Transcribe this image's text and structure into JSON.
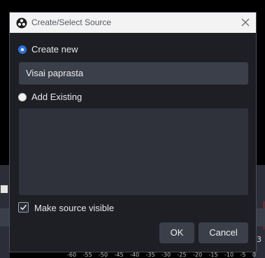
{
  "background": {
    "scale_labels": [
      "-60",
      "-55",
      "-50",
      "-45",
      "-40",
      "-35",
      "-30",
      "-25",
      "-20",
      "-15",
      "-10",
      "-5",
      "0"
    ],
    "right_number": "3"
  },
  "dialog": {
    "title": "Create/Select Source",
    "create_new_label": "Create new",
    "name_value": "Visai paprasta",
    "add_existing_label": "Add Existing",
    "make_visible_label": "Make source visible",
    "ok_label": "OK",
    "cancel_label": "Cancel",
    "create_new_selected": true,
    "make_visible_checked": true
  },
  "colors": {
    "accent": "#2f73d8",
    "dialog_bg": "#1d1f25",
    "input_bg": "#3b3f4a"
  }
}
